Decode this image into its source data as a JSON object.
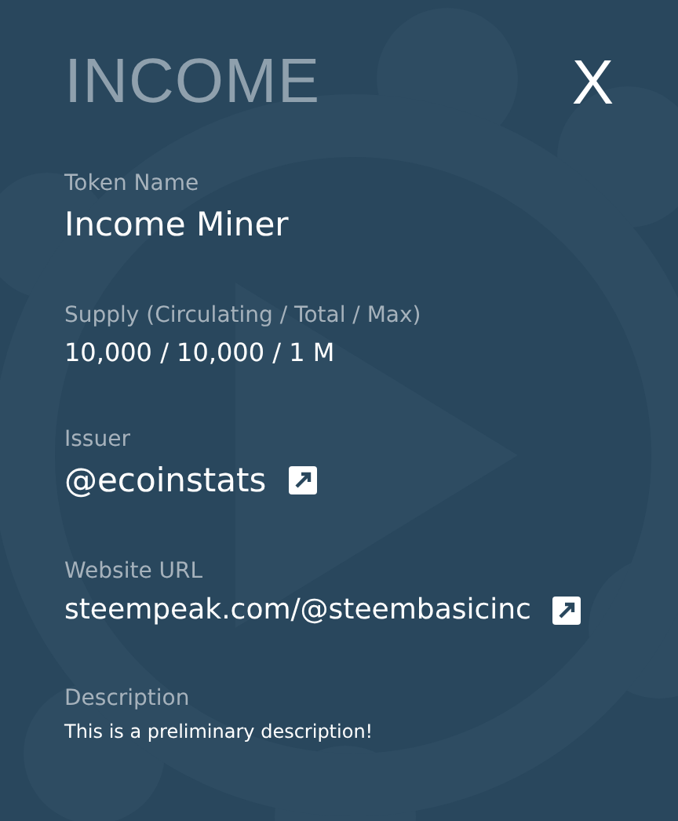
{
  "header": {
    "title": "INCOME",
    "close": "X"
  },
  "fields": [
    {
      "label": "Token Name",
      "value": "Income Miner",
      "kind": "name"
    },
    {
      "label": "Supply (Circulating / Total / Max)",
      "value": "10,000 / 10,000 / 1 M",
      "kind": "figures"
    },
    {
      "label": "Issuer",
      "value": "@ecoinstats",
      "kind": "handle"
    },
    {
      "label": "Website URL",
      "value": "steempeak.com/@steembasicinc",
      "kind": "url"
    },
    {
      "label": "Description",
      "value": "This is a preliminary description!",
      "kind": "note"
    }
  ]
}
